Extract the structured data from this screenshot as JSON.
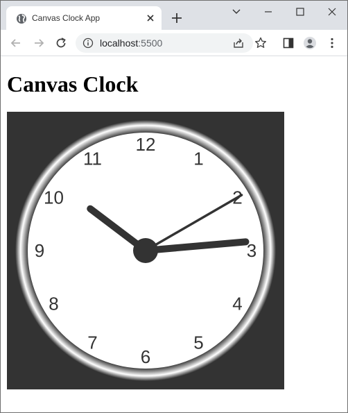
{
  "tab": {
    "title": "Canvas Clock App"
  },
  "address_bar": {
    "host": "localhost",
    "port": ":5500"
  },
  "page": {
    "heading": "Canvas Clock"
  },
  "clock": {
    "numbers": [
      "12",
      "1",
      "2",
      "3",
      "4",
      "5",
      "6",
      "7",
      "8",
      "9",
      "10",
      "11"
    ],
    "time": {
      "hours": 10,
      "minutes": 14,
      "seconds": 10
    },
    "colors": {
      "background": "#333333",
      "face": "#ffffff",
      "hands": "#333333",
      "numbers": "#333333"
    }
  },
  "icons": {
    "tab_favicon": "globe-icon",
    "tab_close": "close-icon",
    "new_tab": "plus-icon",
    "tab_search": "chevron-down-icon",
    "minimize": "minimize-icon",
    "maximize": "maximize-icon",
    "close_window": "close-icon",
    "back": "back-arrow-icon",
    "forward": "forward-arrow-icon",
    "reload": "reload-icon",
    "site_info": "info-icon",
    "share": "share-icon",
    "bookmark": "star-icon",
    "side_panel": "side-panel-icon",
    "profile": "profile-icon",
    "menu": "kebab-menu-icon"
  }
}
